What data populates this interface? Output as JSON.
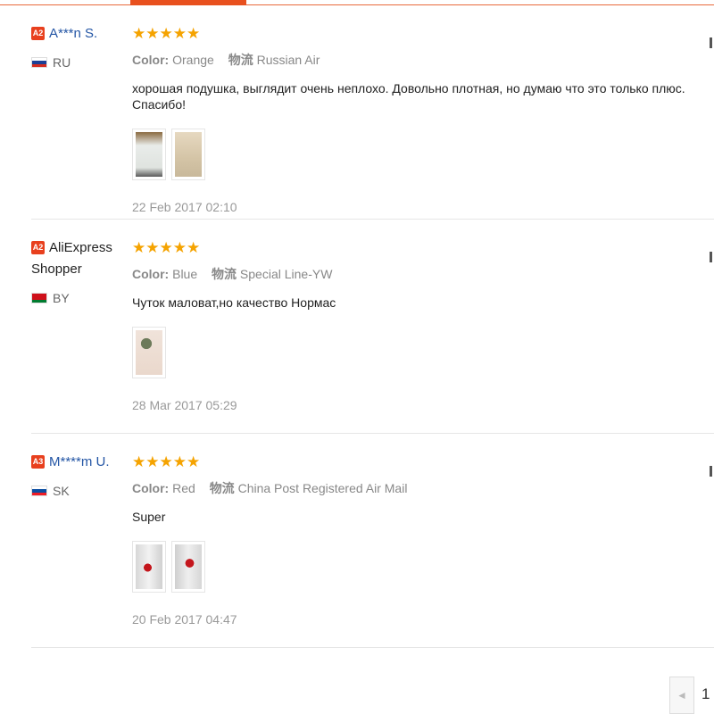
{
  "reviews": [
    {
      "level": "A2",
      "name": "A***n S.",
      "name_style": "link",
      "country": "RU",
      "flag_colors": [
        "#ffffff",
        "#1c3f95",
        "#d52b1e"
      ],
      "stars": "★★★★★",
      "rating": 5,
      "color_label": "Color:",
      "color_value": "Orange",
      "shipping_label": "物流",
      "shipping_value": "Russian Air",
      "text": "хорошая подушка, выглядит очень неплохо. Довольно плотная, но думаю что это только плюс. Спасибо!",
      "thumb_count": 2,
      "date": "22 Feb 2017 02:10"
    },
    {
      "level": "A2",
      "name": "AliExpress Shopper",
      "name_style": "plain",
      "country": "BY",
      "flag_colors": [
        "#cf101a",
        "#cf101a",
        "#007c30"
      ],
      "stars": "★★★★★",
      "rating": 5,
      "color_label": "Color:",
      "color_value": "Blue",
      "shipping_label": "物流",
      "shipping_value": "Special Line-YW",
      "text": "Чуток маловат,но качество Нормас",
      "thumb_count": 1,
      "date": "28 Mar 2017 05:29"
    },
    {
      "level": "A3",
      "name": "M****m U.",
      "name_style": "link",
      "country": "SK",
      "flag_colors": [
        "#ffffff",
        "#0b4ea2",
        "#ee1c25"
      ],
      "stars": "★★★★★",
      "rating": 5,
      "color_label": "Color:",
      "color_value": "Red",
      "shipping_label": "物流",
      "shipping_value": "China Post Registered Air Mail",
      "text": "Super",
      "thumb_count": 2,
      "date": "20 Feb 2017 04:47"
    }
  ],
  "pagination": {
    "prev_icon": "◄",
    "current_page": "1"
  },
  "colors": {
    "accent": "#e8501e",
    "star": "#f5a300",
    "link": "#2456a5"
  }
}
